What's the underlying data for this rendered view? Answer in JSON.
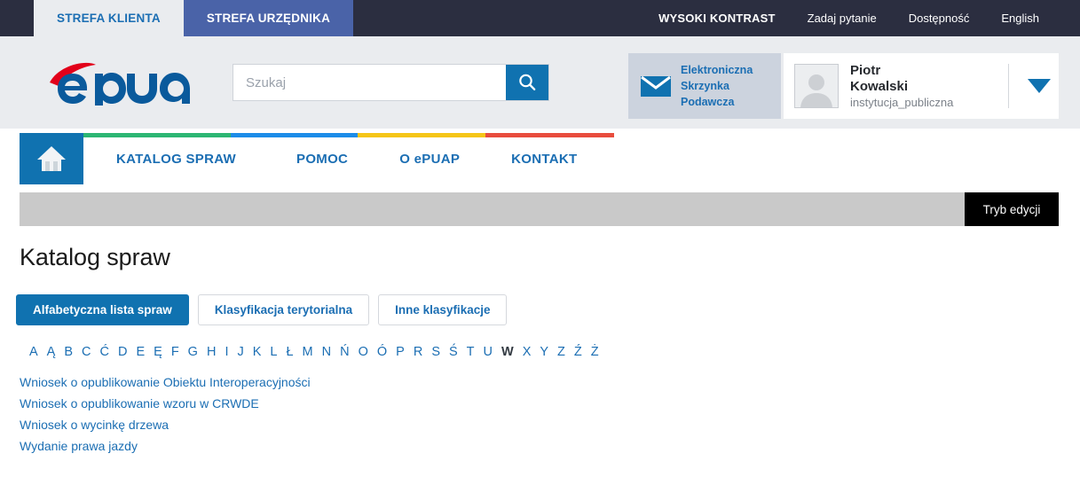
{
  "topbar": {
    "zones": [
      {
        "label": "STREFA KLIENTA",
        "state": "active"
      },
      {
        "label": "STREFA URZĘDNIKA",
        "state": "secondary"
      }
    ],
    "links": [
      {
        "label": "WYSOKI KONTRAST",
        "style": "caps"
      },
      {
        "label": "Zadaj pytanie",
        "style": "normal"
      },
      {
        "label": "Dostępność",
        "style": "normal"
      },
      {
        "label": "English",
        "style": "normal"
      }
    ],
    "background": "#2b2e40"
  },
  "header": {
    "logo_text": "ePUAP",
    "logo_colors": {
      "mark": "#e2001a",
      "word": "#0a5a9c"
    },
    "search": {
      "value": "",
      "placeholder": "Szukaj",
      "icon": "search-icon",
      "button_color": "#1072b0"
    },
    "esp": {
      "icon": "envelope-icon",
      "line1": "Elektroniczna",
      "line2": "Skrzynka",
      "line3": "Podawcza",
      "background": "#ccd3de",
      "text_color": "#1b6eb3"
    },
    "user": {
      "avatar": "user-avatar-placeholder",
      "first_name": "Piotr",
      "last_name": "Kowalski",
      "role": "instytucja_publiczna",
      "caret": "chevron-down-icon"
    }
  },
  "mainnav": {
    "home_icon": "home-icon",
    "colorbar": [
      "#2cb673",
      "#1c8ce8",
      "#f5c518",
      "#e84c3d"
    ],
    "items": [
      {
        "label": "KATALOG SPRAW"
      },
      {
        "label": "POMOC"
      },
      {
        "label": "O ePUAP"
      },
      {
        "label": "KONTAKT"
      }
    ],
    "accent": "#1b6eb3"
  },
  "content": {
    "edit_mode_label": "Tryb edycji",
    "page_title": "Katalog spraw",
    "tabs": [
      {
        "label": "Alfabetyczna lista spraw",
        "state": "active"
      },
      {
        "label": "Klasyfikacja terytorialna",
        "state": "idle"
      },
      {
        "label": "Inne klasyfikacje",
        "state": "idle"
      }
    ],
    "alphabet": [
      {
        "letter": "A",
        "active": false
      },
      {
        "letter": "Ą",
        "active": false
      },
      {
        "letter": "B",
        "active": false
      },
      {
        "letter": "C",
        "active": false
      },
      {
        "letter": "Ć",
        "active": false
      },
      {
        "letter": "D",
        "active": false
      },
      {
        "letter": "E",
        "active": false
      },
      {
        "letter": "Ę",
        "active": false
      },
      {
        "letter": "F",
        "active": false
      },
      {
        "letter": "G",
        "active": false
      },
      {
        "letter": "H",
        "active": false
      },
      {
        "letter": "I",
        "active": false
      },
      {
        "letter": "J",
        "active": false
      },
      {
        "letter": "K",
        "active": false
      },
      {
        "letter": "L",
        "active": false
      },
      {
        "letter": "Ł",
        "active": false
      },
      {
        "letter": "M",
        "active": false
      },
      {
        "letter": "N",
        "active": false
      },
      {
        "letter": "Ń",
        "active": false
      },
      {
        "letter": "O",
        "active": false
      },
      {
        "letter": "Ó",
        "active": false
      },
      {
        "letter": "P",
        "active": false
      },
      {
        "letter": "R",
        "active": false
      },
      {
        "letter": "S",
        "active": false
      },
      {
        "letter": "Ś",
        "active": false
      },
      {
        "letter": "T",
        "active": false
      },
      {
        "letter": "U",
        "active": false
      },
      {
        "letter": "W",
        "active": true
      },
      {
        "letter": "X",
        "active": false
      },
      {
        "letter": "Y",
        "active": false
      },
      {
        "letter": "Z",
        "active": false
      },
      {
        "letter": "Ź",
        "active": false
      },
      {
        "letter": "Ż",
        "active": false
      }
    ],
    "links": [
      {
        "label": "Wniosek o opublikowanie Obiektu Interoperacyjności"
      },
      {
        "label": "Wniosek o opublikowanie wzoru w CRWDE"
      },
      {
        "label": "Wniosek o wycinkę drzewa"
      },
      {
        "label": "Wydanie prawa jazdy"
      }
    ]
  }
}
